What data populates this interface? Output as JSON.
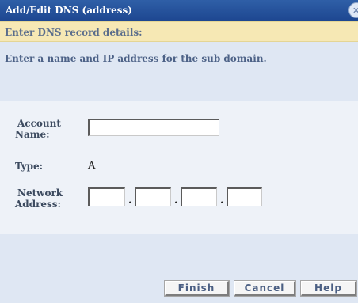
{
  "dialog": {
    "title": "Add/Edit DNS (address)",
    "close_icon": "close-icon"
  },
  "step": {
    "title": "Enter DNS record details:"
  },
  "instruction": {
    "text": "Enter a name and IP address for the sub domain."
  },
  "form": {
    "account_name_label_line1": "Account",
    "account_name_label_line2": "Name:",
    "account_name_value": "",
    "type_label": "Type:",
    "type_value": "A",
    "network_address_label_line1": "Network",
    "network_address_label_line2": "Address:",
    "octets": [
      "",
      "",
      "",
      ""
    ],
    "separator": "."
  },
  "buttons": {
    "finish": "Finish",
    "cancel": "Cancel",
    "help": "Help"
  },
  "colors": {
    "titlebar": "#1d4690",
    "step_bar": "#f6e8b4",
    "panel": "#dfe7f3",
    "label_text": "#3c4a5f"
  }
}
